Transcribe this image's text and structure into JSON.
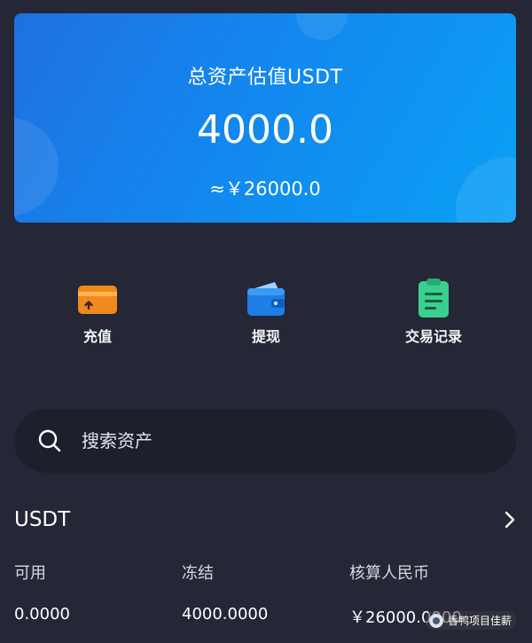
{
  "balance": {
    "title": "总资产估值USDT",
    "amount": "4000.0",
    "cny_estimate": "≈￥26000.0"
  },
  "actions": [
    {
      "label": "充值",
      "icon": "deposit-card-icon",
      "color": "#f08a1e"
    },
    {
      "label": "提现",
      "icon": "wallet-icon",
      "color": "#1e7ee6"
    },
    {
      "label": "交易记录",
      "icon": "clipboard-records-icon",
      "color": "#39d08e"
    }
  ],
  "search": {
    "placeholder": "搜索资产",
    "icon": "search-icon"
  },
  "asset": {
    "name": "USDT",
    "columns": [
      "可用",
      "冻结",
      "核算人民币"
    ],
    "values": [
      "0.0000",
      "4000.0000",
      "￥26000.0000"
    ]
  },
  "watermark": {
    "text": "香鸭项目佳薪"
  },
  "colors": {
    "background": "#252636",
    "card_gradient_start": "#1f70e0",
    "card_gradient_end": "#0aa0f5",
    "search_background": "#1e1f2c"
  }
}
